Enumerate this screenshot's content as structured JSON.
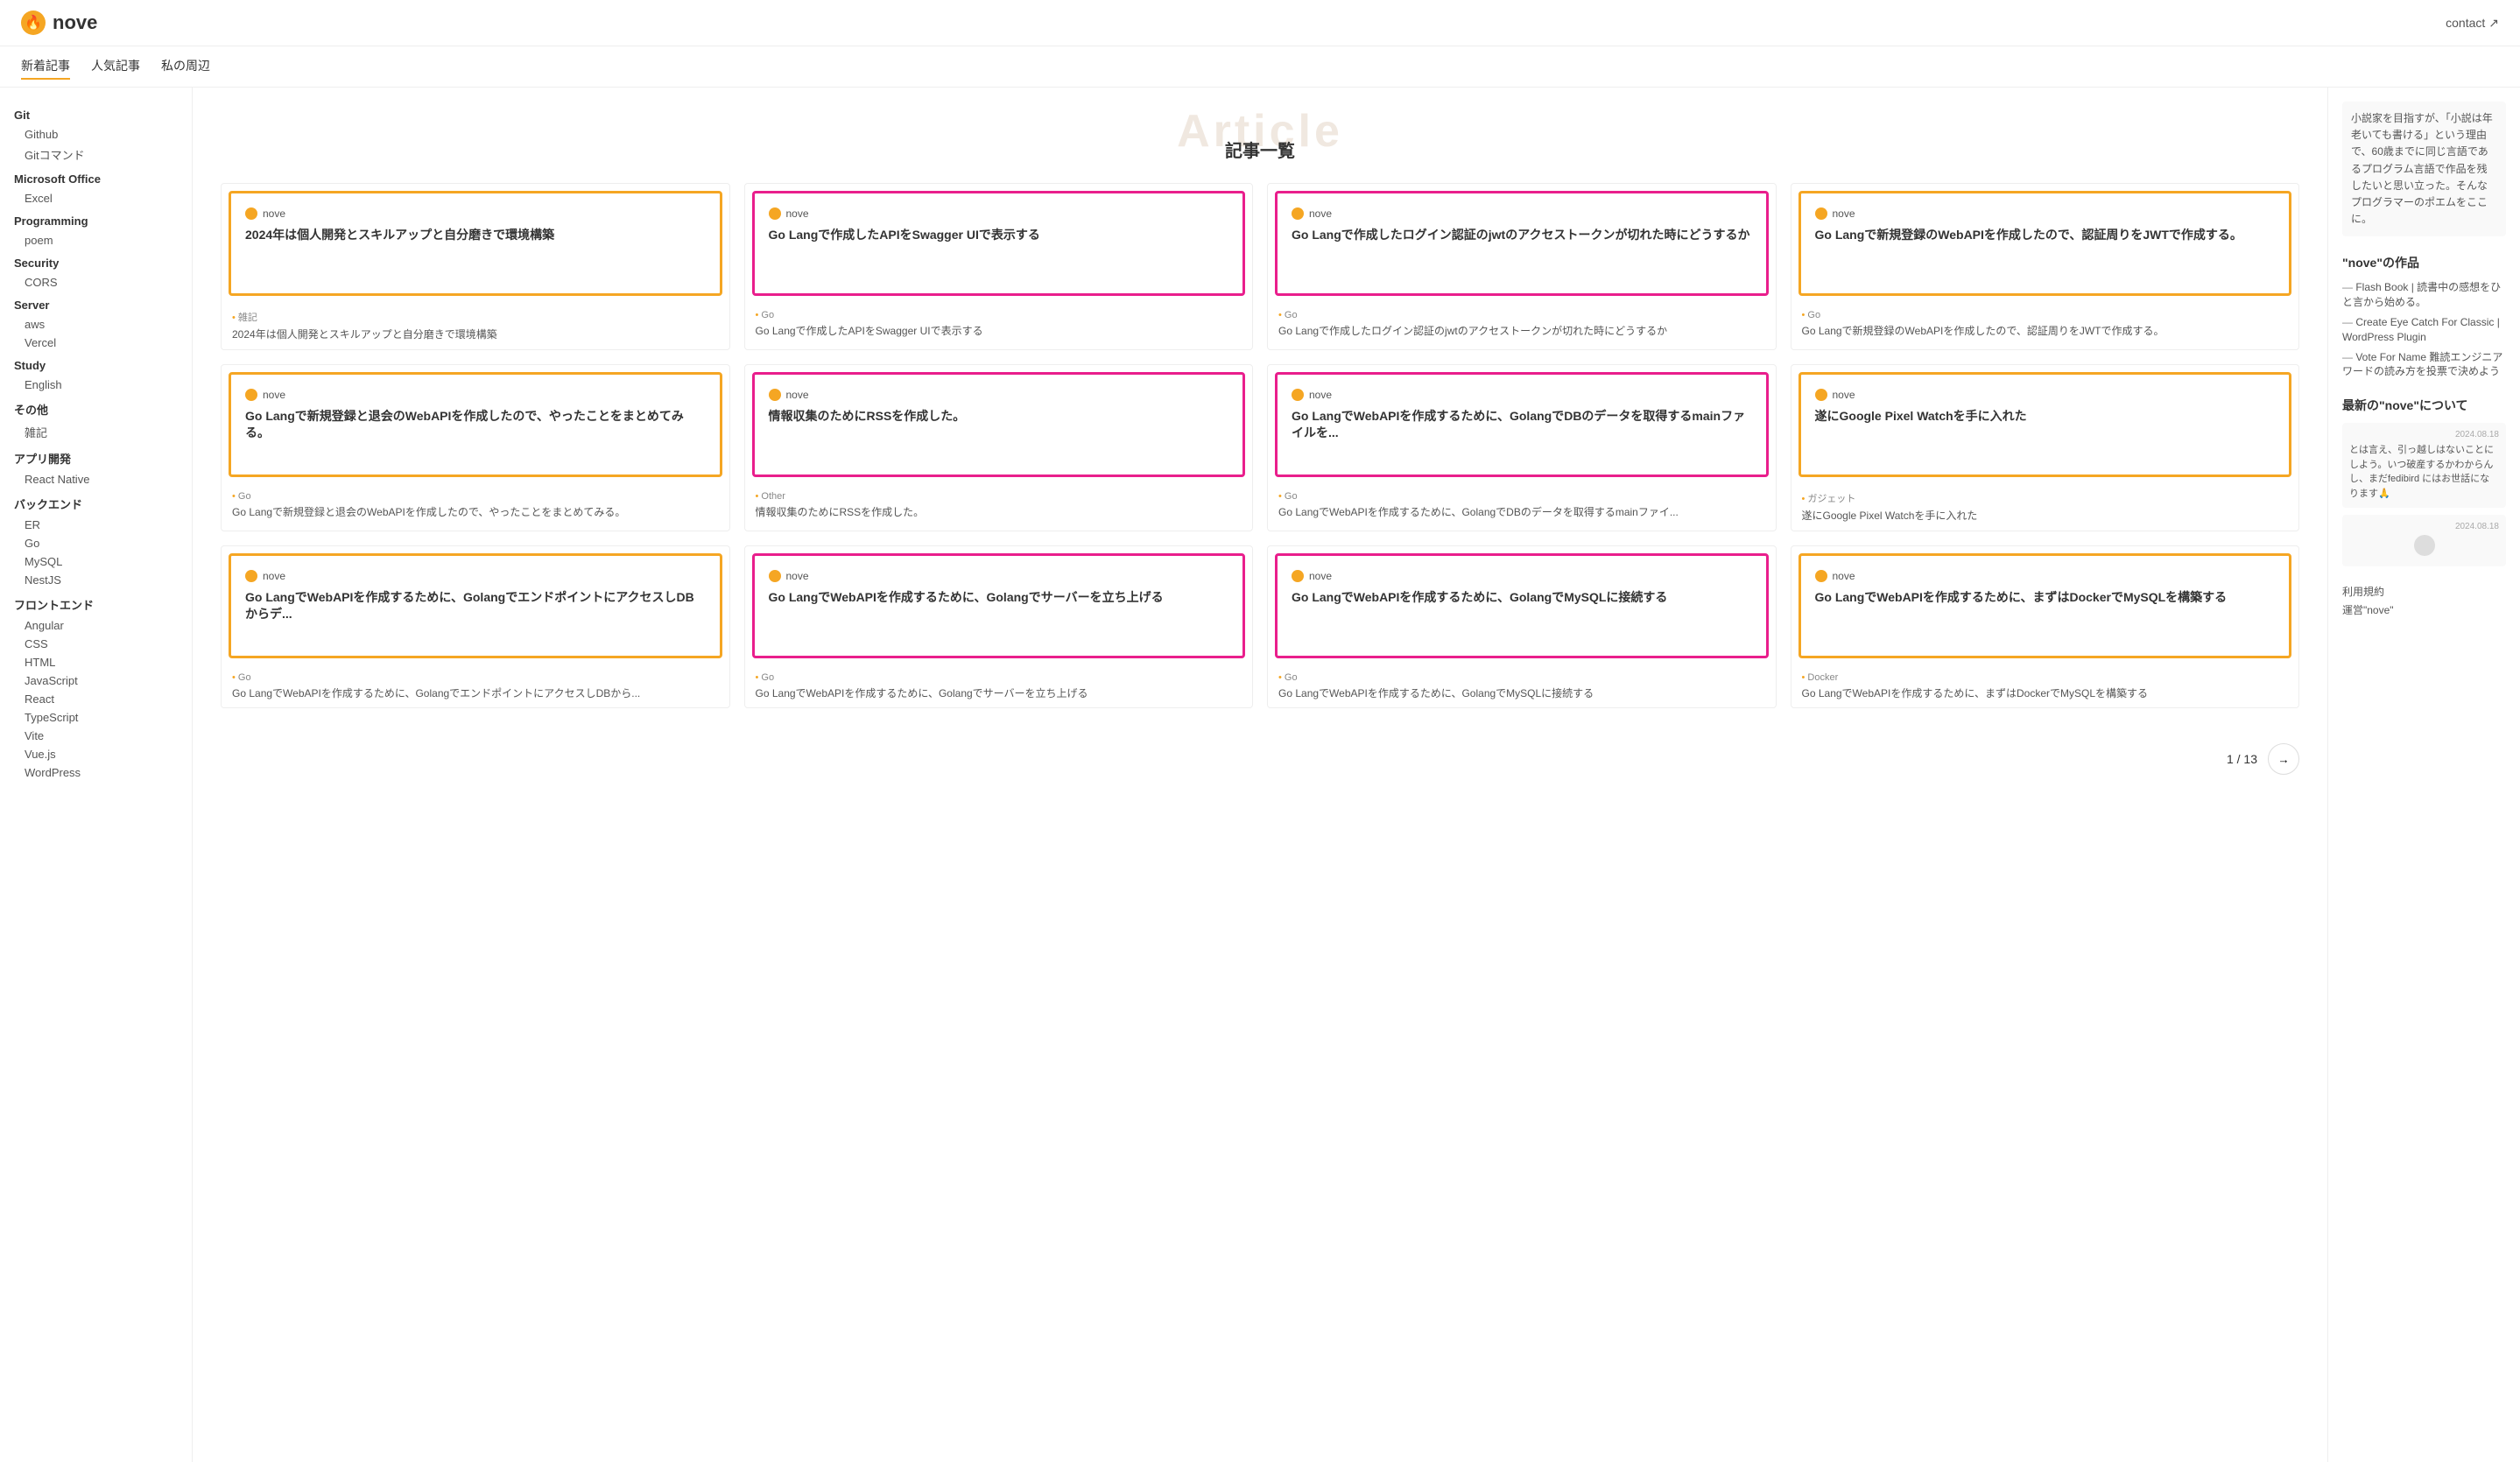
{
  "header": {
    "logo_icon": "🔥",
    "logo_text": "nove",
    "contact_label": "contact",
    "contact_arrow": "↗"
  },
  "nav": {
    "items": [
      {
        "label": "新着記事",
        "active": true
      },
      {
        "label": "人気記事",
        "active": false
      },
      {
        "label": "私の周辺",
        "active": false
      }
    ]
  },
  "sidebar": {
    "categories": [
      {
        "name": "Git",
        "items": [
          "Github",
          "Gitコマンド"
        ]
      },
      {
        "name": "Microsoft Office",
        "items": [
          "Excel"
        ]
      },
      {
        "name": "Programming",
        "items": [
          "poem"
        ]
      },
      {
        "name": "Security",
        "items": [
          "CORS"
        ]
      },
      {
        "name": "Server",
        "items": [
          "aws",
          "Vercel"
        ]
      },
      {
        "name": "Study",
        "items": [
          "English"
        ]
      },
      {
        "name": "その他",
        "items": [
          "雑記"
        ]
      },
      {
        "name": "アプリ開発",
        "items": [
          "React Native"
        ]
      },
      {
        "name": "バックエンド",
        "items": [
          "ER",
          "Go",
          "MySQL",
          "NestJS"
        ]
      },
      {
        "name": "フロントエンド",
        "items": [
          "Angular",
          "CSS",
          "HTML",
          "JavaScript",
          "React",
          "TypeScript",
          "Vite",
          "Vue.js",
          "WordPress"
        ]
      }
    ]
  },
  "page": {
    "title_bg": "Article",
    "title_main": "記事一覧"
  },
  "articles": [
    {
      "id": 1,
      "border_color": "orange",
      "logo_text": "nove",
      "title": "2024年は個人開発とスキルアップと自分磨きで環境構築",
      "tag": "雑記",
      "desc": "2024年は個人開発とスキルアップと自分磨きで環境構築"
    },
    {
      "id": 2,
      "border_color": "pink",
      "logo_text": "nove",
      "title": "Go Langで作成したAPIをSwagger UIで表示する",
      "tag": "Go",
      "desc": "Go Langで作成したAPIをSwagger UIで表示する"
    },
    {
      "id": 3,
      "border_color": "pink",
      "logo_text": "nove",
      "title": "Go Langで作成したログイン認証のjwtのアクセストークンが切れた時にどうするか",
      "tag": "Go",
      "desc": "Go Langで作成したログイン認証のjwtのアクセストークンが切れた時にどうするか"
    },
    {
      "id": 4,
      "border_color": "orange",
      "logo_text": "nove",
      "title": "Go Langで新規登録のWebAPIを作成したので、認証周りをJWTで作成する。",
      "tag": "Go",
      "desc": "Go Langで新規登録のWebAPIを作成したので、認証周りをJWTで作成する。"
    },
    {
      "id": 5,
      "border_color": "orange",
      "logo_text": "nove",
      "title": "Go Langで新規登録と退会のWebAPIを作成したので、やったことをまとめてみる。",
      "tag": "Go",
      "desc": "Go Langで新規登録と退会のWebAPIを作成したので、やったことをまとめてみる。"
    },
    {
      "id": 6,
      "border_color": "pink",
      "logo_text": "nove",
      "title": "情報収集のためにRSSを作成した。",
      "tag": "Other",
      "desc": "情報収集のためにRSSを作成した。"
    },
    {
      "id": 7,
      "border_color": "pink",
      "logo_text": "nove",
      "title": "Go LangでWebAPIを作成するために、GolangでDBのデータを取得するmainファイルを...",
      "tag": "Go",
      "desc": "Go LangでWebAPIを作成するために、GolangでDBのデータを取得するmainファイ..."
    },
    {
      "id": 8,
      "border_color": "orange",
      "logo_text": "nove",
      "title": "遂にGoogle Pixel Watchを手に入れた",
      "tag": "ガジェット",
      "desc": "遂にGoogle Pixel Watchを手に入れた"
    },
    {
      "id": 9,
      "border_color": "orange",
      "logo_text": "nove",
      "title": "Go LangでWebAPIを作成するために、GolangでエンドポイントにアクセスしDBからデ...",
      "tag": "Go",
      "desc": "Go LangでWebAPIを作成するために、GolangでエンドポイントにアクセスしDBから..."
    },
    {
      "id": 10,
      "border_color": "pink",
      "logo_text": "nove",
      "title": "Go LangでWebAPIを作成するために、Golangでサーバーを立ち上げる",
      "tag": "Go",
      "desc": "Go LangでWebAPIを作成するために、Golangでサーバーを立ち上げる"
    },
    {
      "id": 11,
      "border_color": "pink",
      "logo_text": "nove",
      "title": "Go LangでWebAPIを作成するために、GolangでMySQLに接続する",
      "tag": "Go",
      "desc": "Go LangでWebAPIを作成するために、GolangでMySQLに接続する"
    },
    {
      "id": 12,
      "border_color": "orange",
      "logo_text": "nove",
      "title": "Go LangでWebAPIを作成するために、まずはDockerでMySQLを構築する",
      "tag": "Docker",
      "desc": "Go LangでWebAPIを作成するために、まずはDockerでMySQLを構築する"
    }
  ],
  "pagination": {
    "current": "1",
    "total": "13",
    "separator": "/"
  },
  "right_sidebar": {
    "profile_text": "小説家を目指すが、「小説は年老いても書ける」という理由で、60歳までに同じ言語であるプログラム言語で作品を残したいと思い立った。そんなプログラマーのポエムをここに。",
    "works_title": "\"nove\"の作品",
    "works_links": [
      "Flash Book | 読書中の感想をひと言から始める。",
      "Create Eye Catch For Classic | WordPress Plugin",
      "Vote For Name 難読エンジニアワードの読み方を投票で決めよう"
    ],
    "about_title": "最新の\"nove\"について",
    "chat_messages": [
      {
        "date": "2024.08.18",
        "text": "とは言え、引っ越しはないことにしよう。いつ破産するかわからんし、まだfedibird にはお世話になります🙏"
      },
      {
        "date": "2024.08.18",
        "text": ""
      }
    ],
    "footer_links": [
      "利用規約",
      "運営\"nove\""
    ]
  }
}
